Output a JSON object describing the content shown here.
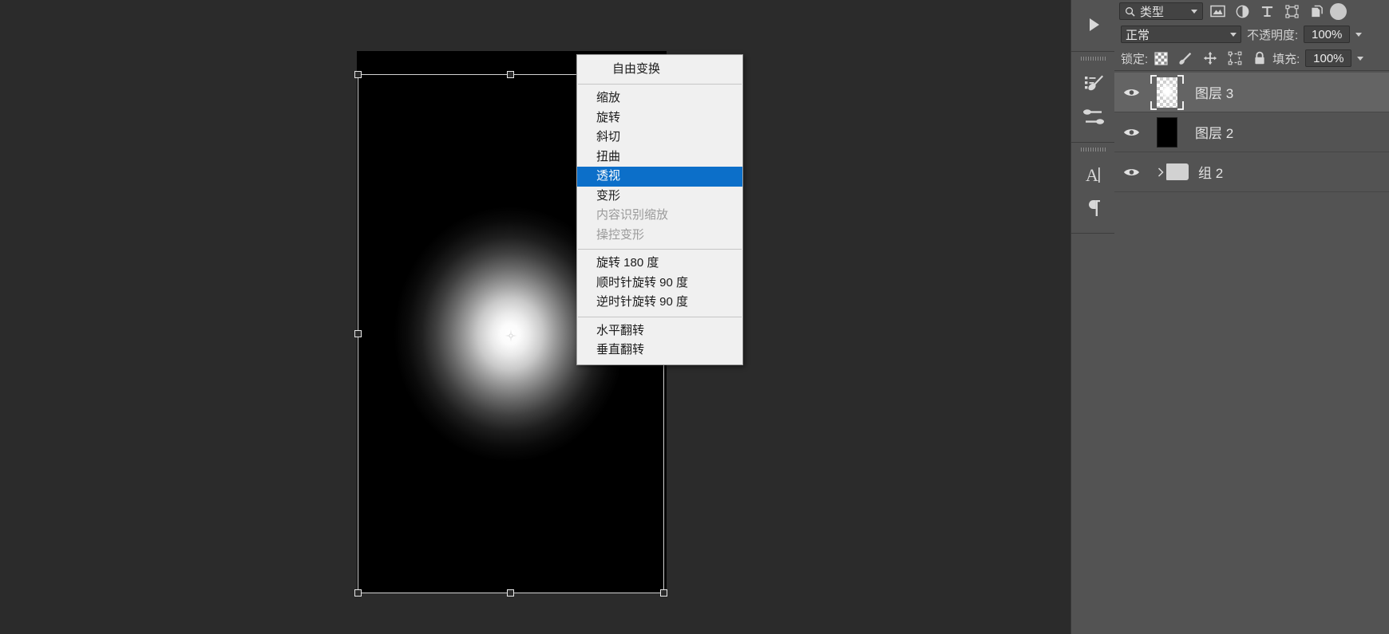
{
  "context_menu": {
    "title": "自由变换",
    "groups": [
      [
        {
          "label": "缩放",
          "state": "normal"
        },
        {
          "label": "旋转",
          "state": "normal"
        },
        {
          "label": "斜切",
          "state": "normal"
        },
        {
          "label": "扭曲",
          "state": "normal"
        },
        {
          "label": "透视",
          "state": "selected"
        },
        {
          "label": "变形",
          "state": "normal"
        },
        {
          "label": "内容识别缩放",
          "state": "disabled"
        },
        {
          "label": "操控变形",
          "state": "disabled"
        }
      ],
      [
        {
          "label": "旋转 180 度",
          "state": "normal"
        },
        {
          "label": "顺时针旋转 90 度",
          "state": "normal"
        },
        {
          "label": "逆时针旋转 90 度",
          "state": "normal"
        }
      ],
      [
        {
          "label": "水平翻转",
          "state": "normal"
        },
        {
          "label": "垂直翻转",
          "state": "normal"
        }
      ]
    ],
    "highlight_color": "#0c6fc9"
  },
  "rail": {
    "buttons": [
      {
        "name": "play-button",
        "icon": "play-icon"
      },
      {
        "name": "brush-presets",
        "icon": "brush-presets-icon"
      },
      {
        "name": "brush-settings",
        "icon": "brush-settings-icon"
      },
      {
        "name": "character-panel",
        "icon": "character-a-icon"
      },
      {
        "name": "paragraph-panel",
        "icon": "paragraph-pilcrow-icon"
      }
    ]
  },
  "layers_panel": {
    "filter": {
      "kind_label": "类型",
      "icons": [
        "pixel-layer-filter-icon",
        "adjustment-layer-filter-icon",
        "type-layer-filter-icon",
        "shape-layer-filter-icon",
        "smart-object-filter-icon"
      ],
      "toggle": "filter-enable-toggle"
    },
    "blend_mode": {
      "value": "正常"
    },
    "opacity": {
      "label": "不透明度:",
      "value": "100%"
    },
    "lock": {
      "label": "锁定:",
      "icons": [
        "lock-transparency-icon",
        "lock-image-pixels-icon",
        "lock-position-icon",
        "lock-artboard-nesting-icon",
        "lock-all-icon"
      ]
    },
    "fill": {
      "label": "填充:",
      "value": "100%"
    },
    "layers": [
      {
        "name": "图层 3",
        "type": "layer",
        "thumb": "transparent-glow",
        "visible": true,
        "selected": true
      },
      {
        "name": "图层 2",
        "type": "layer",
        "thumb": "solid-black",
        "visible": true,
        "selected": false
      },
      {
        "name": "组 2",
        "type": "group",
        "thumb": "folder",
        "visible": true,
        "selected": false,
        "collapsed": true
      }
    ]
  },
  "canvas": {
    "document_thumbnail": "radial-white-glow-on-black",
    "transform": {
      "active": true,
      "handles": [
        "top-left",
        "top-center",
        "top-right",
        "middle-left",
        "middle-right",
        "bottom-left",
        "bottom-center",
        "bottom-right"
      ],
      "reference_point": "center"
    }
  },
  "theme": {
    "panel_bg": "#535353",
    "canvas_bg": "#2b2b2b",
    "menu_bg": "#f0f0f0",
    "accent": "#0c6fc9"
  }
}
